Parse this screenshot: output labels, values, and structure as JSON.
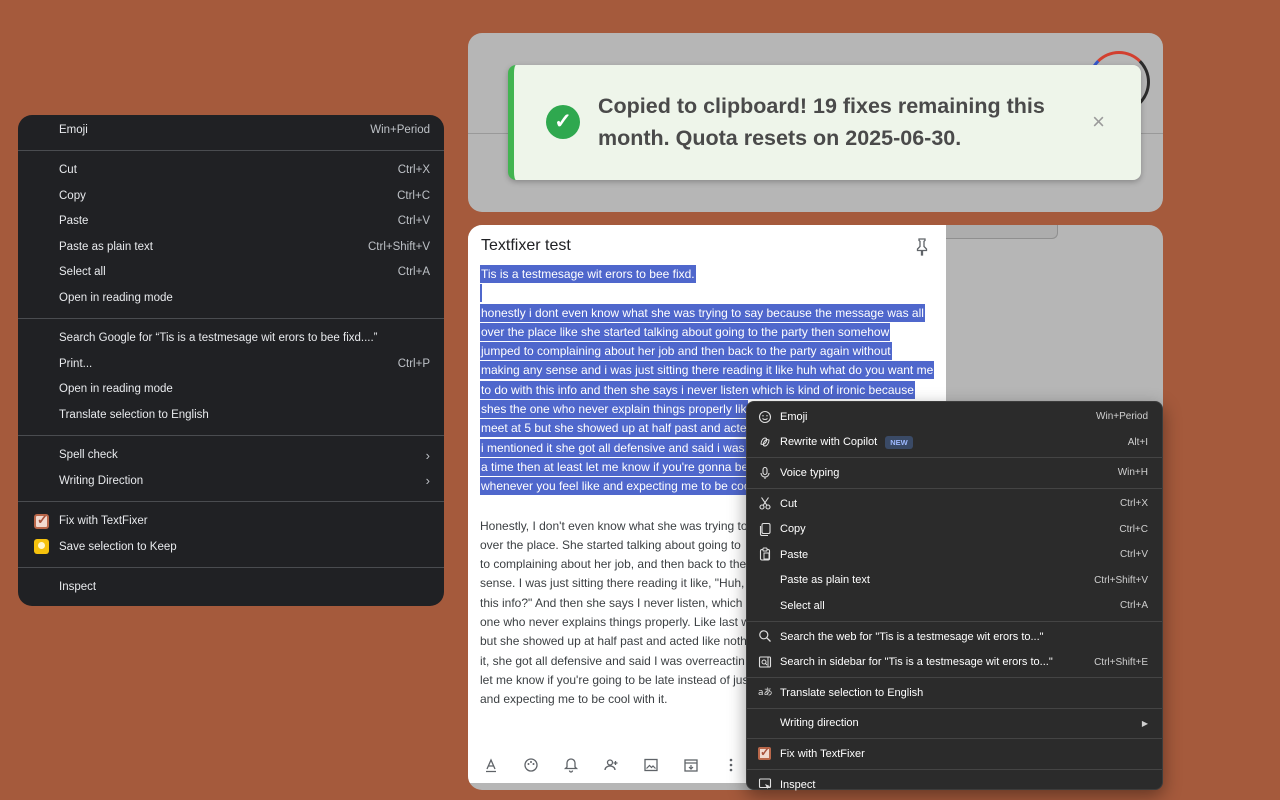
{
  "left_menu": {
    "emoji": {
      "label": "Emoji",
      "shortcut": "Win+Period"
    },
    "cut": {
      "label": "Cut",
      "shortcut": "Ctrl+X"
    },
    "copy": {
      "label": "Copy",
      "shortcut": "Ctrl+C"
    },
    "paste": {
      "label": "Paste",
      "shortcut": "Ctrl+V"
    },
    "paste_plain": {
      "label": "Paste as plain text",
      "shortcut": "Ctrl+Shift+V"
    },
    "select_all": {
      "label": "Select all",
      "shortcut": "Ctrl+A"
    },
    "reading_mode_1": {
      "label": "Open in reading mode"
    },
    "search_google": {
      "label": "Search Google for “Tis is a testmesage wit erors to bee fixd....”"
    },
    "print": {
      "label": "Print...",
      "shortcut": "Ctrl+P"
    },
    "reading_mode_2": {
      "label": "Open in reading mode"
    },
    "translate": {
      "label": "Translate selection to English"
    },
    "spell_check": {
      "label": "Spell check"
    },
    "writing_direction": {
      "label": "Writing Direction"
    },
    "fix_textfixer": {
      "label": "Fix with TextFixer"
    },
    "save_keep": {
      "label": "Save selection to Keep"
    },
    "inspect": {
      "label": "Inspect"
    }
  },
  "toast": {
    "message": "Copied to clipboard! 19 fixes remaining this month. Quota resets on 2025-06-30.",
    "close": "×"
  },
  "note": {
    "title": "Textfixer test",
    "selected_lines": [
      "Tis is a testmesage wit erors to bee fixd.",
      " ",
      "honestly i dont even know what she was trying to say because the message was all",
      "over the place like she started talking about going to the party then somehow",
      "jumped to complaining about her job and then back to the party again without",
      "making any sense and i was just sitting there reading it like huh what do you want me",
      "to do with this info and then she says i never listen which is kind of ironic because",
      "shes the one who never explain things properly lik",
      "meet at 5 but she showed up at half past and acte",
      "i mentioned it she got all defensive and said i was",
      "a time then at least let me know if you're gonna be",
      "whenever you feel like and expecting me to be coo"
    ],
    "fixed_lines": [
      "Honestly, I don't even know what she was trying to",
      "over the place. She started talking about going to",
      "to complaining about her job, and then back to the",
      "sense. I was just sitting there reading it like, \"Huh,",
      "this info?\" And then she says I never listen, which i",
      "one who never explains things properly. Like last w",
      "but she showed up at half past and acted like noth",
      "it, she got all defensive and said I was overreactin",
      "let me know if you're going to be late instead of jus",
      "and expecting me to be cool with it."
    ]
  },
  "right_menu": {
    "emoji": {
      "label": "Emoji",
      "shortcut": "Win+Period"
    },
    "rewrite": {
      "label": "Rewrite with Copilot",
      "badge": "NEW",
      "shortcut": "Alt+I"
    },
    "voice": {
      "label": "Voice typing",
      "shortcut": "Win+H"
    },
    "cut": {
      "label": "Cut",
      "shortcut": "Ctrl+X"
    },
    "copy": {
      "label": "Copy",
      "shortcut": "Ctrl+C"
    },
    "paste": {
      "label": "Paste",
      "shortcut": "Ctrl+V"
    },
    "paste_plain": {
      "label": "Paste as plain text",
      "shortcut": "Ctrl+Shift+V"
    },
    "select_all": {
      "label": "Select all",
      "shortcut": "Ctrl+A"
    },
    "search_web": {
      "label": "Search the web for \"Tis is a testmesage wit erors to...\""
    },
    "search_sidebar": {
      "label": "Search in sidebar for \"Tis is a testmesage wit erors to...\"",
      "shortcut": "Ctrl+Shift+E"
    },
    "translate": {
      "label": "Translate selection to English"
    },
    "writing_direction": {
      "label": "Writing direction"
    },
    "fix_textfixer": {
      "label": "Fix with TextFixer"
    },
    "inspect": {
      "label": "Inspect"
    }
  },
  "colors": {
    "background": "#a55a3c",
    "selection": "#4f67cc",
    "toast_accent": "#42b451"
  }
}
